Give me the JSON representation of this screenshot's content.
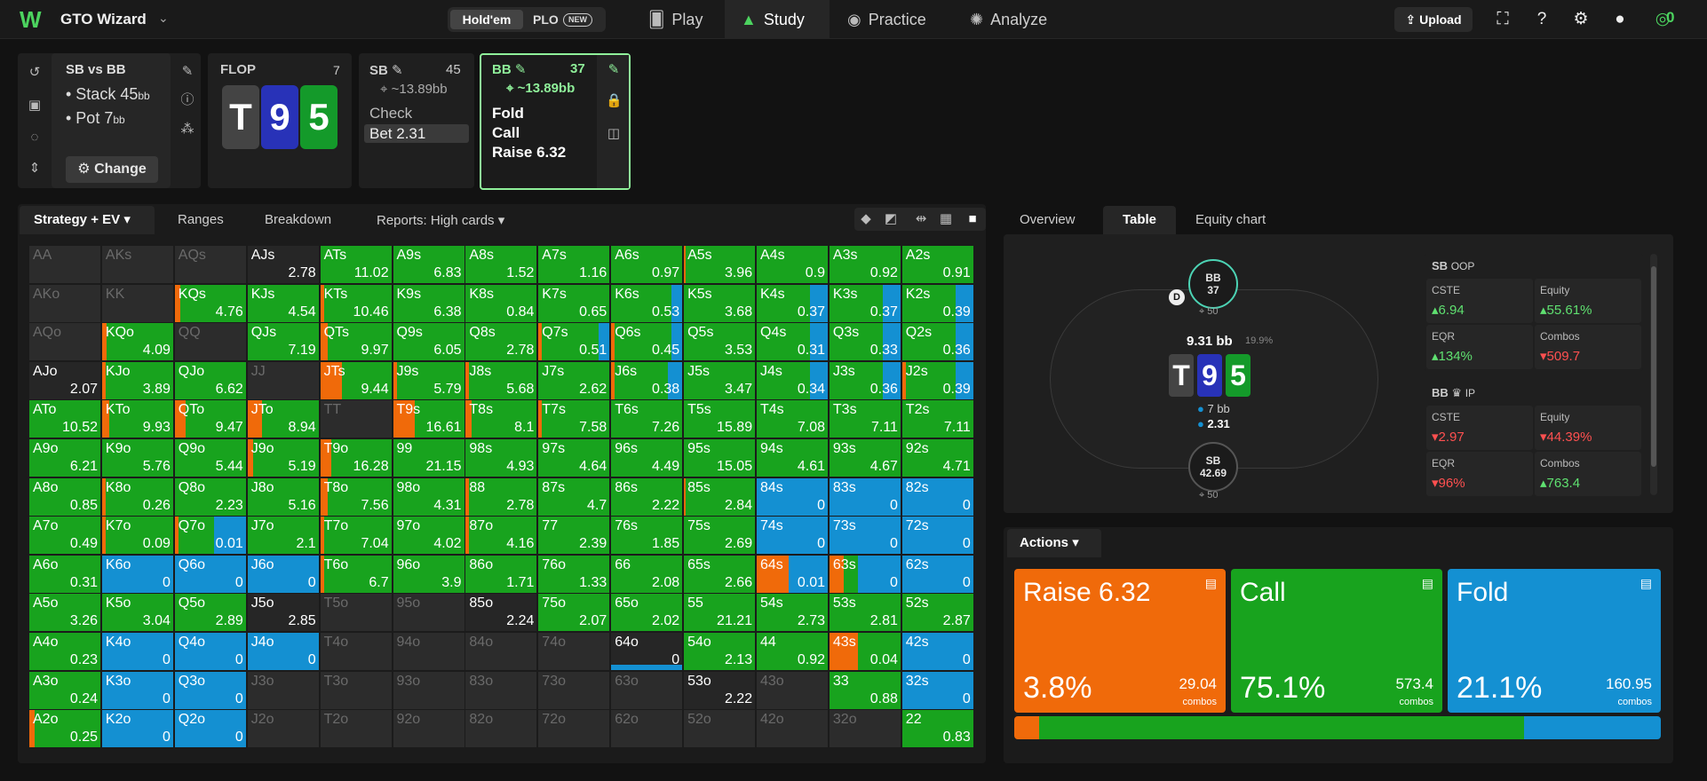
{
  "topbar": {
    "app_name": "GTO Wizard",
    "game_holdem": "Hold'em",
    "game_plo": "PLO",
    "new_badge": "NEW",
    "nav": [
      {
        "label": "Play",
        "icon": "cards-icon"
      },
      {
        "label": "Study",
        "icon": "mortarboard-icon"
      },
      {
        "label": "Practice",
        "icon": "gamepad-icon"
      },
      {
        "label": "Analyze",
        "icon": "bulb-icon"
      }
    ],
    "upload": "Upload",
    "coins": "0"
  },
  "spot": {
    "title": "SB vs BB",
    "stack_label": "• Stack",
    "stack_val": "45",
    "pot_label": "• Pot",
    "pot_val": "7",
    "unit": "bb",
    "change": "Change"
  },
  "flop": {
    "label": "FLOP",
    "count": "7",
    "cards": [
      "T",
      "9",
      "5"
    ]
  },
  "sb_node": {
    "label": "SB",
    "count": "45",
    "stack": "~13.89bb",
    "actions": [
      "Check",
      "Bet 2.31"
    ]
  },
  "bb_node": {
    "label": "BB",
    "count": "37",
    "stack": "~13.89bb",
    "actions": [
      "Fold",
      "Call",
      "Raise 6.32"
    ]
  },
  "tabs_left": {
    "strategy": "Strategy + EV",
    "ranges": "Ranges",
    "breakdown": "Breakdown",
    "reports": "Reports: High cards"
  },
  "tabs_right": {
    "overview": "Overview",
    "table": "Table",
    "equity": "Equity chart"
  },
  "colors": {
    "raise": "#f06a0a",
    "call": "#18a31e",
    "fold": "#1490d2",
    "bg": "#121212"
  },
  "grid": [
    [
      [
        "AA",
        "",
        "n",
        0,
        0,
        0
      ],
      [
        "AKs",
        "",
        "n",
        0,
        0,
        0
      ],
      [
        "AQs",
        "",
        "n",
        0,
        0,
        0
      ],
      [
        "AJs",
        "2.78",
        "x",
        0,
        0,
        0
      ],
      [
        "ATs",
        "11.02",
        "g",
        0,
        100,
        0
      ],
      [
        "A9s",
        "6.83",
        "g",
        0,
        100,
        0
      ],
      [
        "A8s",
        "1.52",
        "g",
        0,
        100,
        0
      ],
      [
        "A7s",
        "1.16",
        "g",
        0,
        100,
        0
      ],
      [
        "A6s",
        "0.97",
        "g",
        0,
        100,
        0
      ],
      [
        "A5s",
        "3.96",
        "g",
        3,
        97,
        0
      ],
      [
        "A4s",
        "0.9",
        "g",
        0,
        100,
        0
      ],
      [
        "A3s",
        "0.92",
        "g",
        0,
        100,
        0
      ],
      [
        "A2s",
        "0.91",
        "g",
        0,
        100,
        0
      ]
    ],
    [
      [
        "AKo",
        "",
        "n",
        0,
        0,
        0
      ],
      [
        "KK",
        "",
        "n",
        0,
        0,
        0
      ],
      [
        "KQs",
        "4.76",
        "g",
        8,
        92,
        0
      ],
      [
        "KJs",
        "4.54",
        "g",
        0,
        100,
        0
      ],
      [
        "KTs",
        "10.46",
        "g",
        5,
        95,
        0
      ],
      [
        "K9s",
        "6.38",
        "g",
        0,
        100,
        0
      ],
      [
        "K8s",
        "0.84",
        "g",
        0,
        100,
        0
      ],
      [
        "K7s",
        "0.65",
        "g",
        0,
        100,
        0
      ],
      [
        "K6s",
        "0.53",
        "g",
        0,
        85,
        15
      ],
      [
        "K5s",
        "3.68",
        "g",
        0,
        100,
        0
      ],
      [
        "K4s",
        "0.37",
        "g",
        0,
        75,
        25
      ],
      [
        "K3s",
        "0.37",
        "g",
        0,
        75,
        25
      ],
      [
        "K2s",
        "0.39",
        "g",
        0,
        75,
        25
      ]
    ],
    [
      [
        "AQo",
        "",
        "n",
        0,
        0,
        0
      ],
      [
        "KQo",
        "4.09",
        "g",
        6,
        94,
        0
      ],
      [
        "QQ",
        "",
        "n",
        0,
        0,
        0
      ],
      [
        "QJs",
        "7.19",
        "g",
        0,
        100,
        0
      ],
      [
        "QTs",
        "9.97",
        "g",
        10,
        90,
        0
      ],
      [
        "Q9s",
        "6.05",
        "g",
        0,
        100,
        0
      ],
      [
        "Q8s",
        "2.78",
        "g",
        0,
        100,
        0
      ],
      [
        "Q7s",
        "0.51",
        "g",
        5,
        80,
        15
      ],
      [
        "Q6s",
        "0.45",
        "g",
        5,
        80,
        15
      ],
      [
        "Q5s",
        "3.53",
        "g",
        0,
        100,
        0
      ],
      [
        "Q4s",
        "0.31",
        "g",
        0,
        75,
        25
      ],
      [
        "Q3s",
        "0.33",
        "g",
        0,
        75,
        25
      ],
      [
        "Q2s",
        "0.36",
        "g",
        0,
        75,
        25
      ]
    ],
    [
      [
        "AJo",
        "2.07",
        "x",
        0,
        0,
        0
      ],
      [
        "KJo",
        "3.89",
        "g",
        5,
        95,
        0
      ],
      [
        "QJo",
        "6.62",
        "g",
        0,
        100,
        0
      ],
      [
        "JJ",
        "",
        "n",
        0,
        0,
        0
      ],
      [
        "JTs",
        "9.44",
        "g",
        30,
        70,
        0
      ],
      [
        "J9s",
        "5.79",
        "g",
        5,
        95,
        0
      ],
      [
        "J8s",
        "5.68",
        "g",
        5,
        95,
        0
      ],
      [
        "J7s",
        "2.62",
        "g",
        0,
        100,
        0
      ],
      [
        "J6s",
        "0.38",
        "g",
        5,
        75,
        20
      ],
      [
        "J5s",
        "3.47",
        "g",
        0,
        100,
        0
      ],
      [
        "J4s",
        "0.34",
        "g",
        0,
        75,
        25
      ],
      [
        "J3s",
        "0.36",
        "g",
        0,
        75,
        25
      ],
      [
        "J2s",
        "0.39",
        "g",
        5,
        70,
        25
      ]
    ],
    [
      [
        "ATo",
        "10.52",
        "g",
        0,
        100,
        0
      ],
      [
        "KTo",
        "9.93",
        "g",
        10,
        90,
        0
      ],
      [
        "QTo",
        "9.47",
        "g",
        15,
        85,
        0
      ],
      [
        "JTo",
        "8.94",
        "g",
        20,
        80,
        0
      ],
      [
        "TT",
        "",
        "n",
        0,
        0,
        0
      ],
      [
        "T9s",
        "16.61",
        "g",
        30,
        70,
        0
      ],
      [
        "T8s",
        "8.1",
        "g",
        8,
        92,
        0
      ],
      [
        "T7s",
        "7.58",
        "g",
        5,
        95,
        0
      ],
      [
        "T6s",
        "7.26",
        "g",
        0,
        100,
        0
      ],
      [
        "T5s",
        "15.89",
        "g",
        0,
        100,
        0
      ],
      [
        "T4s",
        "7.08",
        "g",
        0,
        100,
        0
      ],
      [
        "T3s",
        "7.11",
        "g",
        0,
        100,
        0
      ],
      [
        "T2s",
        "7.11",
        "g",
        0,
        100,
        0
      ]
    ],
    [
      [
        "A9o",
        "6.21",
        "g",
        0,
        100,
        0
      ],
      [
        "K9o",
        "5.76",
        "g",
        0,
        100,
        0
      ],
      [
        "Q9o",
        "5.44",
        "g",
        0,
        100,
        0
      ],
      [
        "J9o",
        "5.19",
        "g",
        8,
        92,
        0
      ],
      [
        "T9o",
        "16.28",
        "g",
        15,
        85,
        0
      ],
      [
        "99",
        "21.15",
        "g",
        0,
        100,
        0
      ],
      [
        "98s",
        "4.93",
        "g",
        0,
        100,
        0
      ],
      [
        "97s",
        "4.64",
        "g",
        0,
        100,
        0
      ],
      [
        "96s",
        "4.49",
        "g",
        0,
        100,
        0
      ],
      [
        "95s",
        "15.05",
        "g",
        0,
        100,
        0
      ],
      [
        "94s",
        "4.61",
        "g",
        0,
        100,
        0
      ],
      [
        "93s",
        "4.67",
        "g",
        0,
        100,
        0
      ],
      [
        "92s",
        "4.71",
        "g",
        0,
        100,
        0
      ]
    ],
    [
      [
        "A8o",
        "0.85",
        "g",
        0,
        100,
        0
      ],
      [
        "K8o",
        "0.26",
        "g",
        5,
        95,
        0
      ],
      [
        "Q8o",
        "2.23",
        "g",
        0,
        100,
        0
      ],
      [
        "J8o",
        "5.16",
        "g",
        0,
        100,
        0
      ],
      [
        "T8o",
        "7.56",
        "g",
        10,
        90,
        0
      ],
      [
        "98o",
        "4.31",
        "g",
        0,
        100,
        0
      ],
      [
        "88",
        "2.78",
        "g",
        5,
        95,
        0
      ],
      [
        "87s",
        "4.7",
        "g",
        0,
        100,
        0
      ],
      [
        "86s",
        "2.22",
        "g",
        0,
        100,
        0
      ],
      [
        "85s",
        "2.84",
        "g",
        3,
        97,
        0
      ],
      [
        "84s",
        "0",
        "b",
        0,
        0,
        100
      ],
      [
        "83s",
        "0",
        "b",
        0,
        0,
        100
      ],
      [
        "82s",
        "0",
        "b",
        0,
        0,
        100
      ]
    ],
    [
      [
        "A7o",
        "0.49",
        "g",
        0,
        100,
        0
      ],
      [
        "K7o",
        "0.09",
        "g",
        5,
        95,
        0
      ],
      [
        "Q7o",
        "0.01",
        "g",
        5,
        50,
        45
      ],
      [
        "J7o",
        "2.1",
        "g",
        0,
        100,
        0
      ],
      [
        "T7o",
        "7.04",
        "g",
        5,
        95,
        0
      ],
      [
        "97o",
        "4.02",
        "g",
        0,
        100,
        0
      ],
      [
        "87o",
        "4.16",
        "g",
        5,
        95,
        0
      ],
      [
        "77",
        "2.39",
        "g",
        0,
        100,
        0
      ],
      [
        "76s",
        "1.85",
        "g",
        0,
        100,
        0
      ],
      [
        "75s",
        "2.69",
        "g",
        0,
        100,
        0
      ],
      [
        "74s",
        "0",
        "b",
        0,
        0,
        100
      ],
      [
        "73s",
        "0",
        "b",
        0,
        0,
        100
      ],
      [
        "72s",
        "0",
        "b",
        0,
        0,
        100
      ]
    ],
    [
      [
        "A6o",
        "0.31",
        "g",
        0,
        100,
        0
      ],
      [
        "K6o",
        "0",
        "b",
        0,
        0,
        100
      ],
      [
        "Q6o",
        "0",
        "b",
        0,
        0,
        100
      ],
      [
        "J6o",
        "0",
        "b",
        0,
        0,
        100
      ],
      [
        "T6o",
        "6.7",
        "g",
        5,
        95,
        0
      ],
      [
        "96o",
        "3.9",
        "g",
        0,
        100,
        0
      ],
      [
        "86o",
        "1.71",
        "g",
        0,
        100,
        0
      ],
      [
        "76o",
        "1.33",
        "g",
        0,
        100,
        0
      ],
      [
        "66",
        "2.08",
        "g",
        0,
        100,
        0
      ],
      [
        "65s",
        "2.66",
        "g",
        0,
        100,
        0
      ],
      [
        "64s",
        "0.01",
        "g",
        45,
        0,
        55
      ],
      [
        "63s",
        "0",
        "b",
        20,
        20,
        60
      ],
      [
        "62s",
        "0",
        "b",
        0,
        0,
        100
      ]
    ],
    [
      [
        "A5o",
        "3.26",
        "g",
        0,
        100,
        0
      ],
      [
        "K5o",
        "3.04",
        "g",
        0,
        100,
        0
      ],
      [
        "Q5o",
        "2.89",
        "g",
        0,
        100,
        0
      ],
      [
        "J5o",
        "2.85",
        "x",
        0,
        0,
        0
      ],
      [
        "T5o",
        "",
        "n",
        0,
        0,
        0
      ],
      [
        "95o",
        "",
        "n",
        0,
        0,
        0
      ],
      [
        "85o",
        "2.24",
        "x",
        0,
        0,
        0
      ],
      [
        "75o",
        "2.07",
        "g",
        0,
        100,
        0
      ],
      [
        "65o",
        "2.02",
        "g",
        0,
        100,
        0
      ],
      [
        "55",
        "21.21",
        "g",
        0,
        100,
        0
      ],
      [
        "54s",
        "2.73",
        "g",
        0,
        100,
        0
      ],
      [
        "53s",
        "2.81",
        "g",
        0,
        100,
        0
      ],
      [
        "52s",
        "2.87",
        "g",
        0,
        100,
        0
      ]
    ],
    [
      [
        "A4o",
        "0.23",
        "g",
        0,
        100,
        0
      ],
      [
        "K4o",
        "0",
        "b",
        0,
        0,
        100
      ],
      [
        "Q4o",
        "0",
        "b",
        0,
        0,
        100
      ],
      [
        "J4o",
        "0",
        "b",
        0,
        0,
        100
      ],
      [
        "T4o",
        "",
        "n",
        0,
        0,
        0
      ],
      [
        "94o",
        "",
        "n",
        0,
        0,
        0
      ],
      [
        "84o",
        "",
        "n",
        0,
        0,
        0
      ],
      [
        "74o",
        "",
        "n",
        0,
        0,
        0
      ],
      [
        "64o",
        "0",
        "x",
        0,
        0,
        0
      ],
      [
        "54o",
        "2.13",
        "g",
        0,
        100,
        0
      ],
      [
        "44",
        "0.92",
        "g",
        0,
        100,
        0
      ],
      [
        "43s",
        "0.04",
        "g",
        40,
        60,
        0
      ],
      [
        "42s",
        "0",
        "b",
        0,
        0,
        100
      ]
    ],
    [
      [
        "A3o",
        "0.24",
        "g",
        0,
        100,
        0
      ],
      [
        "K3o",
        "0",
        "b",
        0,
        0,
        100
      ],
      [
        "Q3o",
        "0",
        "b",
        0,
        0,
        100
      ],
      [
        "J3o",
        "",
        "n",
        0,
        0,
        0
      ],
      [
        "T3o",
        "",
        "n",
        0,
        0,
        0
      ],
      [
        "93o",
        "",
        "n",
        0,
        0,
        0
      ],
      [
        "83o",
        "",
        "n",
        0,
        0,
        0
      ],
      [
        "73o",
        "",
        "n",
        0,
        0,
        0
      ],
      [
        "63o",
        "",
        "n",
        0,
        0,
        0
      ],
      [
        "53o",
        "2.22",
        "x",
        0,
        0,
        0
      ],
      [
        "43o",
        "",
        "n",
        0,
        0,
        0
      ],
      [
        "33",
        "0.88",
        "g",
        0,
        100,
        0
      ],
      [
        "32s",
        "0",
        "b",
        0,
        0,
        100
      ]
    ],
    [
      [
        "A2o",
        "0.25",
        "g",
        8,
        92,
        0
      ],
      [
        "K2o",
        "0",
        "b",
        0,
        0,
        100
      ],
      [
        "Q2o",
        "0",
        "b",
        0,
        0,
        100
      ],
      [
        "J2o",
        "",
        "n",
        0,
        0,
        0
      ],
      [
        "T2o",
        "",
        "n",
        0,
        0,
        0
      ],
      [
        "92o",
        "",
        "n",
        0,
        0,
        0
      ],
      [
        "82o",
        "",
        "n",
        0,
        0,
        0
      ],
      [
        "72o",
        "",
        "n",
        0,
        0,
        0
      ],
      [
        "62o",
        "",
        "n",
        0,
        0,
        0
      ],
      [
        "52o",
        "",
        "n",
        0,
        0,
        0
      ],
      [
        "42o",
        "",
        "n",
        0,
        0,
        0
      ],
      [
        "32o",
        "",
        "n",
        0,
        0,
        0
      ],
      [
        "22",
        "0.83",
        "g",
        0,
        100,
        0
      ]
    ]
  ],
  "table_view": {
    "pot": "9.31 bb",
    "pot_pct": "19.9%",
    "bb_seat": "BB",
    "bb_stack": "37",
    "bb_cnt": "50",
    "sb_seat": "SB",
    "sb_stack": "42.69",
    "sb_cnt": "50",
    "bet1": "7 bb",
    "bet2": "2.31",
    "dealer": "D"
  },
  "stats": {
    "sb": {
      "head": "SB",
      "pos": "OOP",
      "cste_l": "CSTE",
      "cste": "6.94",
      "eq_l": "Equity",
      "eq": "55.61%",
      "eqr_l": "EQR",
      "eqr": "134%",
      "combos_l": "Combos",
      "combos": "509.7"
    },
    "bb": {
      "head": "BB",
      "pos": "IP",
      "cste_l": "CSTE",
      "cste": "2.97",
      "eq_l": "Equity",
      "eq": "44.39%",
      "eqr_l": "EQR",
      "eqr": "96%",
      "combos_l": "Combos",
      "combos": "763.4"
    }
  },
  "actions": {
    "header": "Actions",
    "raise": {
      "name": "Raise 6.32",
      "pct": "3.8%",
      "combos": "29.04",
      "combos_l": "combos",
      "frac": 0.038
    },
    "call": {
      "name": "Call",
      "pct": "75.1%",
      "combos": "573.4",
      "combos_l": "combos",
      "frac": 0.751
    },
    "fold": {
      "name": "Fold",
      "pct": "21.1%",
      "combos": "160.95",
      "combos_l": "combos",
      "frac": 0.211
    }
  }
}
